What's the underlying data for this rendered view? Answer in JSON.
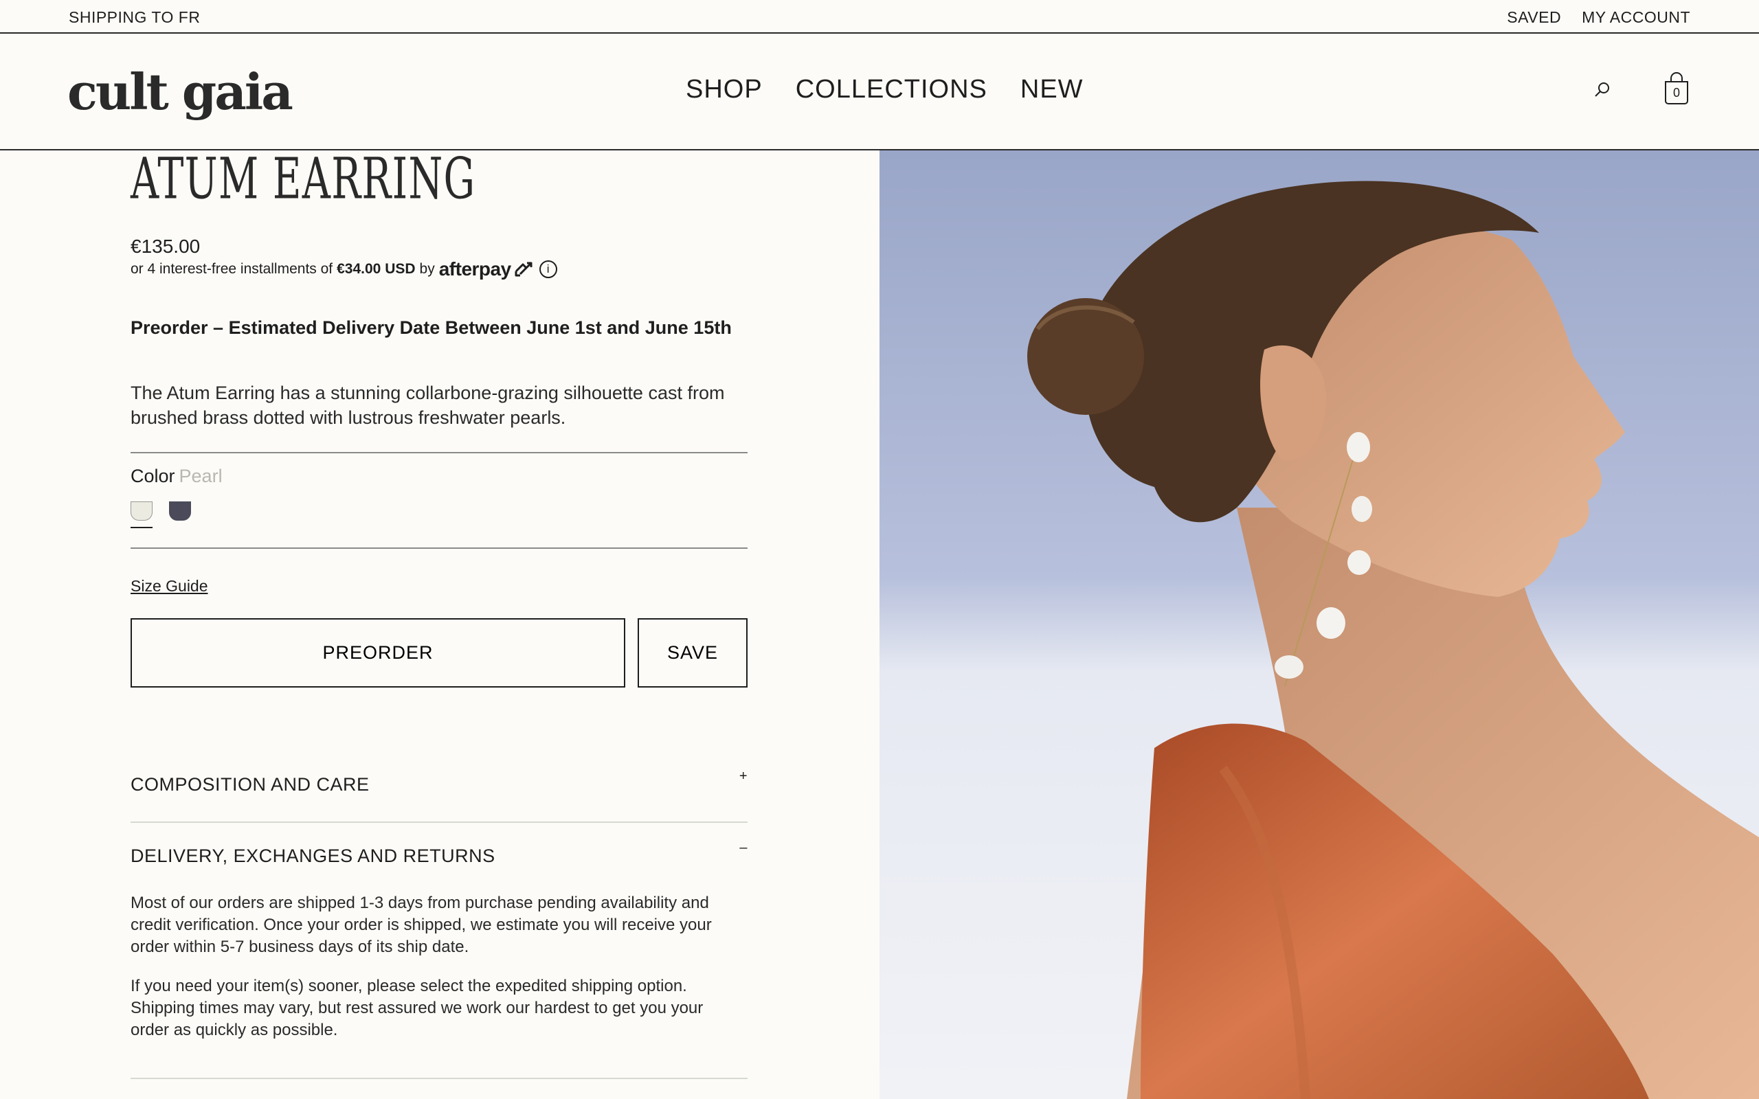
{
  "topbar": {
    "shipping": "SHIPPING TO FR",
    "saved": "SAVED",
    "account": "MY ACCOUNT"
  },
  "header": {
    "logo": "cult gaia",
    "nav": [
      "SHOP",
      "COLLECTIONS",
      "NEW"
    ],
    "cart_count": "0",
    "icons": [
      "search-icon",
      "shopping-bag-icon"
    ]
  },
  "product": {
    "title": "ATUM EARRING",
    "price": "€135.00",
    "afterpay_prefix": "or 4 interest-free installments of",
    "afterpay_amount": "€34.00 USD",
    "afterpay_by": "by",
    "afterpay_brand": "afterpay",
    "preorder_note": "Preorder – Estimated Delivery Date Between June 1st and June 15th",
    "description": "The Atum Earring has a stunning collarbone-grazing silhouette cast from brushed brass dotted with lustrous freshwater pearls.",
    "color_label": "Color",
    "color_value": "Pearl",
    "swatches": [
      {
        "name": "Pearl",
        "color": "#ecebe2"
      },
      {
        "name": "Slate",
        "color": "#4a4a5a"
      }
    ],
    "size_guide": "Size Guide",
    "preorder_button": "PREORDER",
    "save_button": "SAVE"
  },
  "accordion": [
    {
      "title": "COMPOSITION AND CARE",
      "sign": "+",
      "open": false
    },
    {
      "title": "DELIVERY, EXCHANGES AND RETURNS",
      "sign": "–",
      "open": true,
      "paragraphs": [
        "Most of our orders are shipped 1-3 days from purchase pending availability and credit verification. Once your order is shipped, we estimate you will receive your order within 5-7 business days of its ship date.",
        "If you need your item(s) sooner, please select the expedited shipping option. Shipping times may vary, but rest assured we work our hardest to get you your order as quickly as possible."
      ]
    }
  ],
  "colors": {
    "background": "#fcfbf7",
    "text": "#1e1e1e",
    "muted": "#b8b8b0",
    "dress": "#b8562e",
    "sky": "#a9b6d6"
  }
}
